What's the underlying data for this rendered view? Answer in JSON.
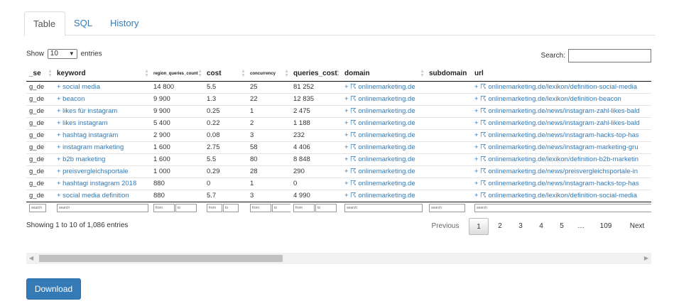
{
  "tabs": [
    {
      "label": "Table",
      "active": true
    },
    {
      "label": "SQL",
      "active": false
    },
    {
      "label": "History",
      "active": false
    }
  ],
  "length_menu": {
    "prefix": "Show",
    "value": "10",
    "suffix": "entries"
  },
  "search": {
    "label": "Search:",
    "value": ""
  },
  "columns": [
    "_se",
    "keyword",
    "region_queries_count",
    "cost",
    "concurrency",
    "queries_cost",
    "domain",
    "subdomain",
    "url"
  ],
  "rows": [
    [
      "g_de",
      "+ social media",
      "14 800",
      "5.5",
      "25",
      "81 252",
      "+ ☈ onlinemarketing.de",
      "",
      "+ ☈ onlinemarketing.de/lexikon/definition-social-media"
    ],
    [
      "g_de",
      "+ beacon",
      "9 900",
      "1.3",
      "22",
      "12 835",
      "+ ☈ onlinemarketing.de",
      "",
      "+ ☈ onlinemarketing.de/lexikon/definition-beacon"
    ],
    [
      "g_de",
      "+ likes für instagram",
      "9 900",
      "0.25",
      "1",
      "2 475",
      "+ ☈ onlinemarketing.de",
      "",
      "+ ☈ onlinemarketing.de/news/instagram-zahl-likes-bald"
    ],
    [
      "g_de",
      "+ likes instagram",
      "5 400",
      "0.22",
      "2",
      "1 188",
      "+ ☈ onlinemarketing.de",
      "",
      "+ ☈ onlinemarketing.de/news/instagram-zahl-likes-bald"
    ],
    [
      "g_de",
      "+ hashtag instagram",
      "2 900",
      "0.08",
      "3",
      "232",
      "+ ☈ onlinemarketing.de",
      "",
      "+ ☈ onlinemarketing.de/news/instagram-hacks-top-has"
    ],
    [
      "g_de",
      "+ instagram marketing",
      "1 600",
      "2.75",
      "58",
      "4 406",
      "+ ☈ onlinemarketing.de",
      "",
      "+ ☈ onlinemarketing.de/news/instagram-marketing-gru"
    ],
    [
      "g_de",
      "+ b2b marketing",
      "1 600",
      "5.5",
      "80",
      "8 848",
      "+ ☈ onlinemarketing.de",
      "",
      "+ ☈ onlinemarketing.de/lexikon/definition-b2b-marketin"
    ],
    [
      "g_de",
      "+ preisvergleichsportale",
      "1 000",
      "0.29",
      "28",
      "290",
      "+ ☈ onlinemarketing.de",
      "",
      "+ ☈ onlinemarketing.de/news/preisvergleichsportale-in"
    ],
    [
      "g_de",
      "+ hashtagi instagram 2018",
      "880",
      "0",
      "1",
      "0",
      "+ ☈ onlinemarketing.de",
      "",
      "+ ☈ onlinemarketing.de/news/instagram-hacks-top-has"
    ],
    [
      "g_de",
      "+ social media definition",
      "880",
      "5.7",
      "3",
      "4 990",
      "+ ☈ onlinemarketing.de",
      "",
      "+ ☈ onlinemarketing.de/lexikon/definition-social-media"
    ]
  ],
  "filters": {
    "search": "search",
    "from": "from",
    "to": "to"
  },
  "info": "Showing 1 to 10 of 1,086 entries",
  "pagination": [
    "Previous",
    "1",
    "2",
    "3",
    "4",
    "5",
    "…",
    "109",
    "Next"
  ],
  "pagination_current": "1",
  "download_label": "Download"
}
